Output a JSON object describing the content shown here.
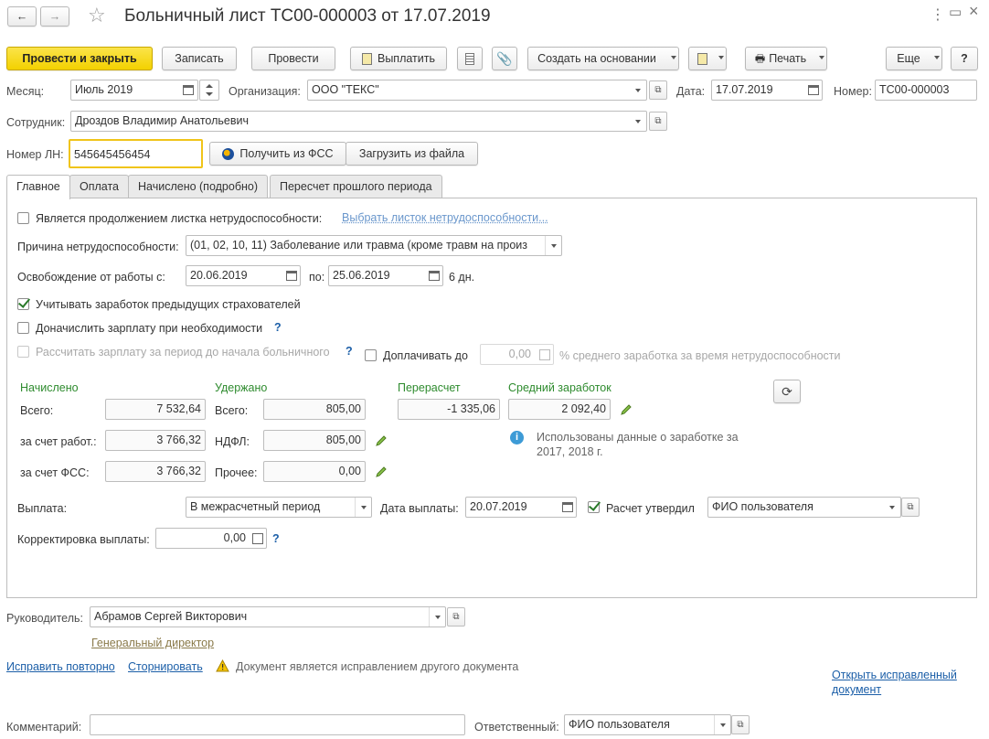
{
  "window": {
    "title": "Больничный лист ТС00-000003 от 17.07.2019",
    "nav_back": "←",
    "nav_forward": "→",
    "star": "☆",
    "menu_dots": "⋮",
    "restore": "▭",
    "close": "×"
  },
  "toolbar": {
    "post_close": "Провести и закрыть",
    "save": "Записать",
    "post": "Провести",
    "pay": "Выплатить",
    "create_based_on": "Создать на основании",
    "print": "Печать",
    "more": "Еще",
    "help": "?"
  },
  "header": {
    "month_label": "Месяц:",
    "month_value": "Июль 2019",
    "org_label": "Организация:",
    "org_value": "ООО \"ТЕКС\"",
    "date_label": "Дата:",
    "date_value": "17.07.2019",
    "number_label": "Номер:",
    "number_value": "ТС00-000003",
    "employee_label": "Сотрудник:",
    "employee_value": "Дроздов Владимир Анатольевич",
    "ln_label": "Номер ЛН:",
    "ln_value": "545645456454",
    "get_fss": "Получить из ФСС",
    "load_file": "Загрузить из файла"
  },
  "tabs": [
    {
      "label": "Главное",
      "active": true
    },
    {
      "label": "Оплата",
      "active": false
    },
    {
      "label": "Начислено (подробно)",
      "active": false
    },
    {
      "label": "Пересчет прошлого периода",
      "active": false
    }
  ],
  "main": {
    "continuation_label": "Является продолжением листка нетрудоспособности:",
    "continuation_checked": false,
    "continuation_link": "Выбрать листок нетрудоспособности...",
    "reason_label": "Причина нетрудоспособности:",
    "reason_value": "(01, 02, 10, 11) Заболевание или травма (кроме травм на произ",
    "release_label": "Освобождение от работы с:",
    "release_from": "20.06.2019",
    "release_to_label": "по:",
    "release_to": "25.06.2019",
    "days": "6 дн.",
    "consider_prev_label": "Учитывать заработок предыдущих страхователей",
    "consider_prev_checked": true,
    "accrue_salary_label": "Доначислить зарплату при необходимости",
    "accrue_salary_checked": false,
    "calc_salary_label": "Рассчитать зарплату за период до начала больничного",
    "calc_salary_checked": false,
    "top_up_label": "Доплачивать до",
    "top_up_checked": false,
    "top_up_value": "0,00",
    "top_up_suffix": "% среднего заработка за время нетрудоспособности",
    "help_mark": "?"
  },
  "amounts": {
    "accrued_header": "Начислено",
    "withheld_header": "Удержано",
    "recalc_header": "Перерасчет",
    "avg_header": "Средний заработок",
    "total_label": "Всего:",
    "total_accrued": "7 532,64",
    "employer_label": "за счет работ.:",
    "employer_value": "3 766,32",
    "fss_label": "за счет ФСС:",
    "fss_value": "3 766,32",
    "withheld_total_label": "Всего:",
    "withheld_total": "805,00",
    "ndfl_label": "НДФЛ:",
    "ndfl_value": "805,00",
    "other_label": "Прочее:",
    "other_value": "0,00",
    "recalc_value": "-1 335,06",
    "avg_value": "2 092,40",
    "info_text_1": "Использованы данные о заработке за",
    "info_text_2": "2017,  2018 г."
  },
  "payment": {
    "payout_label": "Выплата:",
    "payout_value": "В межрасчетный период",
    "pay_date_label": "Дата выплаты:",
    "pay_date_value": "20.07.2019",
    "approved_label": "Расчет утвердил",
    "approved_checked": true,
    "approved_value": "ФИО пользователя",
    "correction_label": "Корректировка выплаты:",
    "correction_value": "0,00"
  },
  "footer": {
    "manager_label": "Руководитель:",
    "manager_value": "Абрамов Сергей Викторович",
    "manager_position": "Генеральный директор",
    "fix_again": "Исправить повторно",
    "reverse": "Сторнировать",
    "warning_text": "Документ является исправлением другого документа",
    "open_fixed_1": "Открыть исправленный",
    "open_fixed_2": "документ",
    "comment_label": "Комментарий:",
    "comment_value": "",
    "responsible_label": "Ответственный:",
    "responsible_value": "ФИО пользователя"
  },
  "colors": {
    "primary_button": "#f3d100",
    "link": "#1c5fa8",
    "section_header": "#2e8b2e",
    "focus_border": "#f0c419"
  }
}
